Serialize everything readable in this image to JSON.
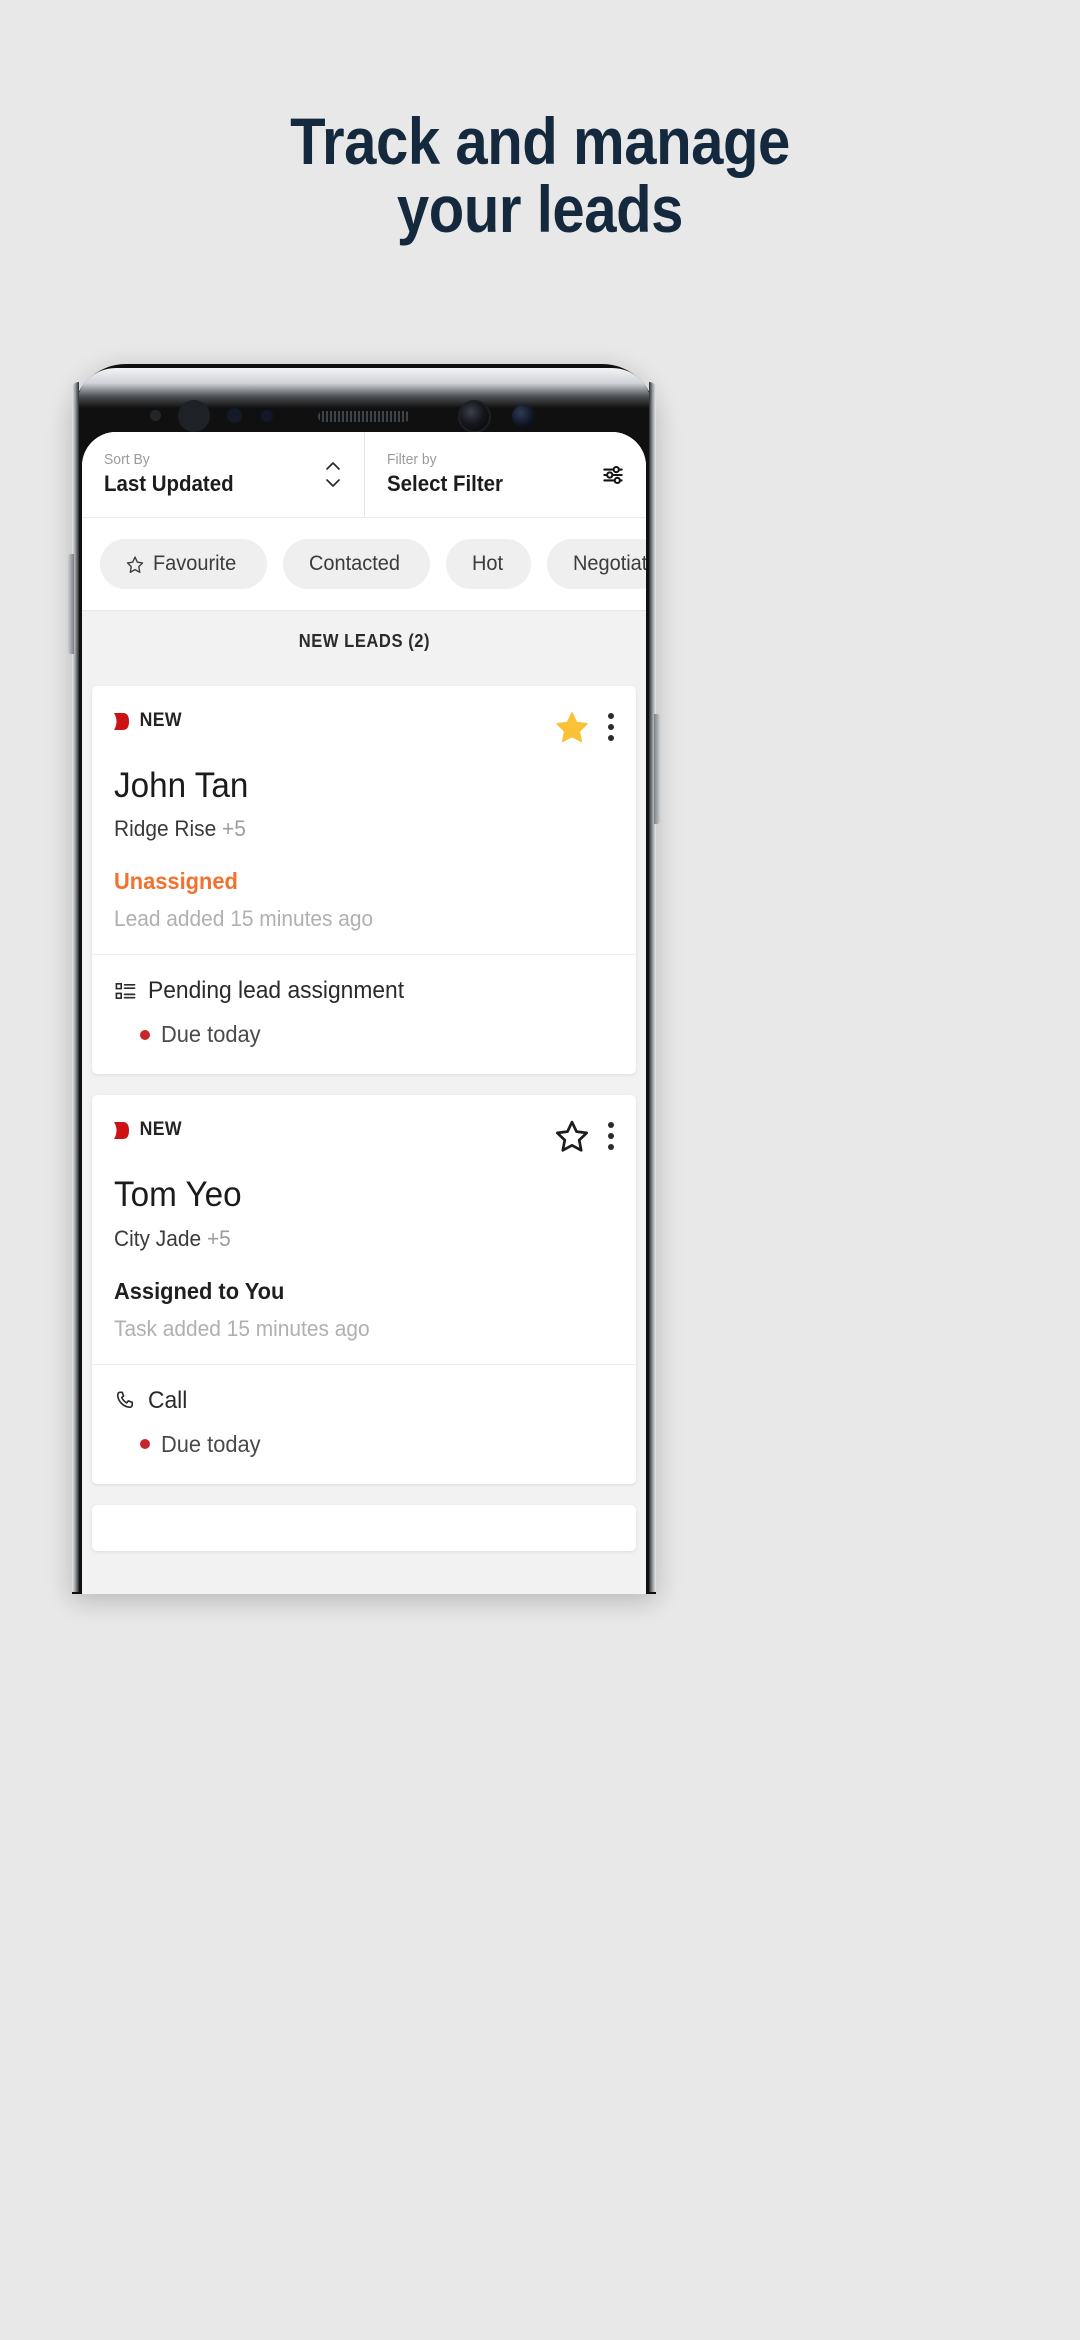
{
  "headline": {
    "line1": "Track and manage",
    "line2": "your leads",
    "color": "#14293d"
  },
  "screen": {
    "sort": {
      "label": "Sort By",
      "value": "Last Updated",
      "icon": "chevron-up-down-icon"
    },
    "filter": {
      "label": "Filter by",
      "value": "Select Filter",
      "icon": "sliders-icon"
    },
    "chips": [
      {
        "label": "Favourite",
        "icon": "star-outline-icon"
      },
      {
        "label": "Contacted",
        "icon": ""
      },
      {
        "label": "Hot",
        "icon": ""
      },
      {
        "label": "Negotiating",
        "icon": ""
      }
    ],
    "section_header": "NEW LEADS (2)",
    "cards": [
      {
        "tag": "NEW",
        "tag_icon": "red-flag-icon",
        "starred": true,
        "star_icon": "star-filled-icon",
        "menu_icon": "kebab-menu-icon",
        "name": "John Tan",
        "property": "Ridge Rise",
        "property_more": "+5",
        "status": "Unassigned",
        "status_color": "#f4702e",
        "meta": "Lead added 15 minutes ago",
        "task_icon": "task-list-icon",
        "task": "Pending lead assignment",
        "due": "Due today",
        "due_color": "#c9252d"
      },
      {
        "tag": "NEW",
        "tag_icon": "red-flag-icon",
        "starred": false,
        "star_icon": "star-outline-icon",
        "menu_icon": "kebab-menu-icon",
        "name": "Tom Yeo",
        "property": "City Jade",
        "property_more": "+5",
        "status": "Assigned to You",
        "status_color": "#1f1f1f",
        "meta": "Task added 15 minutes ago",
        "task_icon": "phone-call-icon",
        "task": "Call",
        "due": "Due today",
        "due_color": "#c9252d"
      }
    ]
  }
}
